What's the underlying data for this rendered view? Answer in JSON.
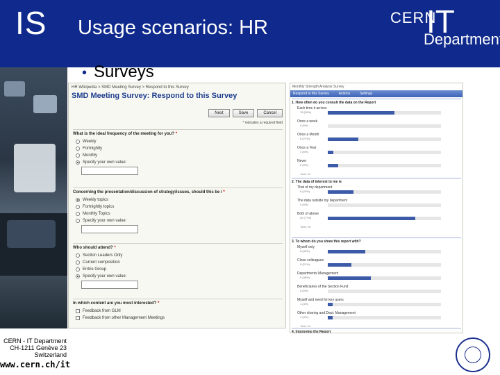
{
  "slide": {
    "logo_text": "IS",
    "title": "Usage scenarios: HR",
    "bullet": "Surveys",
    "cern_logo": {
      "cern": "CERN",
      "it": "IT",
      "department": "Department"
    },
    "footer": {
      "line1": "CERN - IT Department",
      "line2": "CH-1211 Genève 23",
      "line3": "Switzerland",
      "url": "www.cern.ch/it"
    }
  },
  "form": {
    "breadcrumb": "HR Wikipedia > SMD Meeting Survey > Respond to this Survey",
    "title": "SMD Meeting Survey: Respond to this Survey",
    "buttons": {
      "next": "Next",
      "save": "Save",
      "cancel": "Cancel"
    },
    "required_note": "* indicates a required field",
    "questions": [
      {
        "title": "What is the ideal frequency of the meeting for you?",
        "type": "radio",
        "options": [
          "Weekly",
          "Fortnightly",
          "Monthly",
          "Specify your own value:"
        ],
        "selected": 3,
        "has_textbox": true
      },
      {
        "title": "Concerning the presentation/discussion of strategy/issues, should this be i",
        "type": "radio",
        "options": [
          "Weekly topics",
          "Fortnightly topics",
          "Monthly Topics",
          "Specify your own value:"
        ],
        "selected": 0,
        "has_textbox": true
      },
      {
        "title": "Who should attend?",
        "type": "radio",
        "options": [
          "Section Leaders Only",
          "Current composition",
          "Entire Group",
          "Specify your own value:"
        ],
        "selected": 3,
        "has_textbox": true
      },
      {
        "title": "In which content are you most interested?",
        "type": "checkbox",
        "options": [
          "Feedback from GLM",
          "Feedback from other Management Meetings"
        ],
        "has_textbox": false
      }
    ]
  },
  "results": {
    "header": "Monthly Strength Analysis Survey",
    "toolbar": [
      "Respond to this Survey",
      "Actions",
      "Settings"
    ],
    "questions": [
      {
        "title": "1. How often do you consult the data on the Report",
        "options": [
          {
            "label": "Each time it arrives",
            "count": "13 (59%)",
            "value": 59
          },
          {
            "label": "Once a week",
            "count": "0 (0%)",
            "value": 0
          },
          {
            "label": "Once a Month",
            "count": "6 (27%)",
            "value": 27
          },
          {
            "label": "Once a Year",
            "count": "1 (5%)",
            "value": 5
          },
          {
            "label": "Never",
            "count": "2 (9%)",
            "value": 9
          }
        ],
        "total": "Total: 22"
      },
      {
        "title": "2. The data of interest to me is",
        "options": [
          {
            "label": "That of my department",
            "count": "6 (23%)",
            "value": 23
          },
          {
            "label": "The data outside my department",
            "count": "0 (0%)",
            "value": 0
          },
          {
            "label": "Both of above",
            "count": "20 (77%)",
            "value": 77
          }
        ],
        "total": "Total: 26"
      },
      {
        "title": "3. To whom do you show this report with?",
        "options": [
          {
            "label": "Myself only",
            "count": "8 (33%)",
            "value": 33
          },
          {
            "label": "Close colleagues",
            "count": "5 (21%)",
            "value": 21
          },
          {
            "label": "Departments Management",
            "count": "9 (38%)",
            "value": 38
          },
          {
            "label": "Beneficiaries of the Section Fund",
            "count": "0 (0%)",
            "value": 0
          },
          {
            "label": "Myself and need for key users",
            "count": "1 (4%)",
            "value": 4
          },
          {
            "label": "Other sharing and Dept. Management",
            "count": "1 (4%)",
            "value": 4
          }
        ],
        "total": "Total: 24"
      }
    ],
    "next_section": "4. Improving the Report"
  },
  "colors": {
    "header_blue": "#0f2a8c",
    "bar_blue": "#3b5aa8",
    "title_blue": "#1d3d8f"
  }
}
